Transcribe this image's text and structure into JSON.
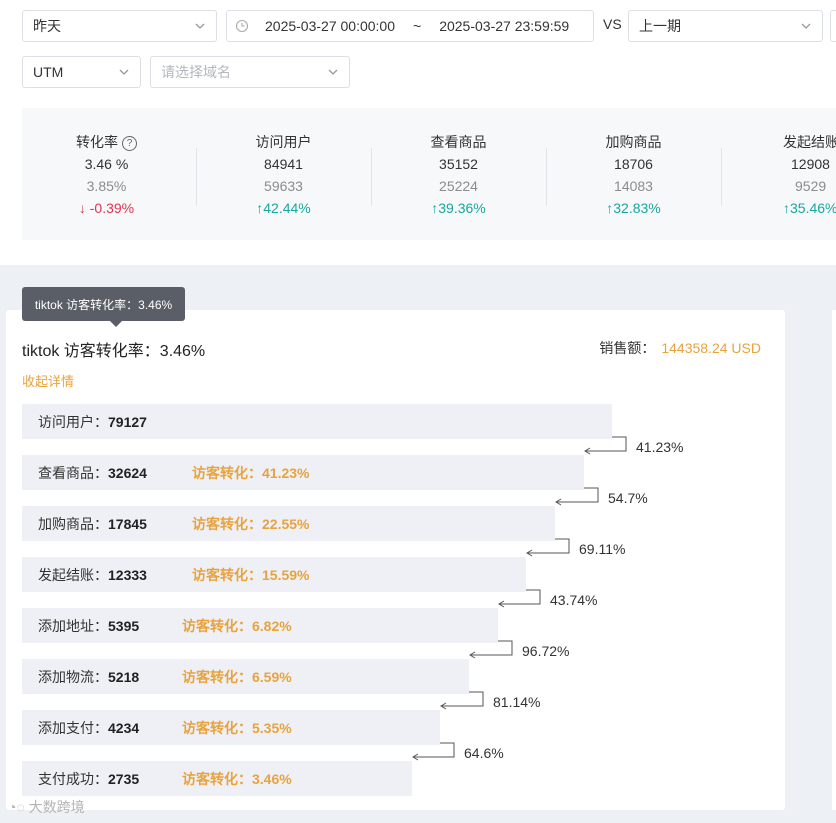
{
  "filters": {
    "date_preset": "昨天",
    "date_start": "2025-03-27 00:00:00",
    "date_sep": "~",
    "date_end": "2025-03-27 23:59:59",
    "vs_label": "VS",
    "compare": "上一期",
    "utm": "UTM",
    "domain_placeholder": "请选择域名"
  },
  "metrics": [
    {
      "label": "转化率",
      "current": "3.46 %",
      "previous": "3.85%",
      "change": "-0.39%",
      "arrow": "↓",
      "dir": "down",
      "help": "?"
    },
    {
      "label": "访问用户",
      "current": "84941",
      "previous": "59633",
      "change": "42.44%",
      "arrow": "↑",
      "dir": "up"
    },
    {
      "label": "查看商品",
      "current": "35152",
      "previous": "25224",
      "change": "39.36%",
      "arrow": "↑",
      "dir": "up"
    },
    {
      "label": "加购商品",
      "current": "18706",
      "previous": "14083",
      "change": "32.83%",
      "arrow": "↑",
      "dir": "up"
    },
    {
      "label": "发起结账",
      "current": "12908",
      "previous": "9529",
      "change": "35.46%",
      "arrow": "↑",
      "dir": "up"
    }
  ],
  "funnel": {
    "tooltip": "tiktok 访客转化率：3.46%",
    "title": "tiktok 访客转化率：3.46%",
    "sales_label": "销售额：",
    "sales_value": "144358.24 USD",
    "collapse_label": "收起详情",
    "conv_prefix": "访客转化：",
    "steps": [
      {
        "label": "访问用户：",
        "value": "79127",
        "width": 0.72,
        "conv": ""
      },
      {
        "label": "查看商品：",
        "value": "32624",
        "width": 0.685,
        "conv": "访客转化：41.23%"
      },
      {
        "label": "加购商品：",
        "value": "17845",
        "width": 0.65,
        "conv": "访客转化：22.55%"
      },
      {
        "label": "发起结账：",
        "value": "12333",
        "width": 0.615,
        "conv": "访客转化：15.59%"
      },
      {
        "label": "添加地址：",
        "value": "5395",
        "width": 0.58,
        "conv": "访客转化：6.82%"
      },
      {
        "label": "添加物流：",
        "value": "5218",
        "width": 0.545,
        "conv": "访客转化：6.59%"
      },
      {
        "label": "添加支付：",
        "value": "4234",
        "width": 0.51,
        "conv": "访客转化：5.35%"
      },
      {
        "label": "支付成功：",
        "value": "2735",
        "width": 0.475,
        "conv": "访客转化：3.46%"
      }
    ],
    "rates": [
      "41.23%",
      "54.7%",
      "69.11%",
      "43.74%",
      "96.72%",
      "81.14%",
      "64.6%"
    ]
  },
  "brand": "大数跨境",
  "colors": {
    "accent": "#e8a33d",
    "up": "#18a79f",
    "down": "#e1344e",
    "bar": "#eef0f6"
  }
}
